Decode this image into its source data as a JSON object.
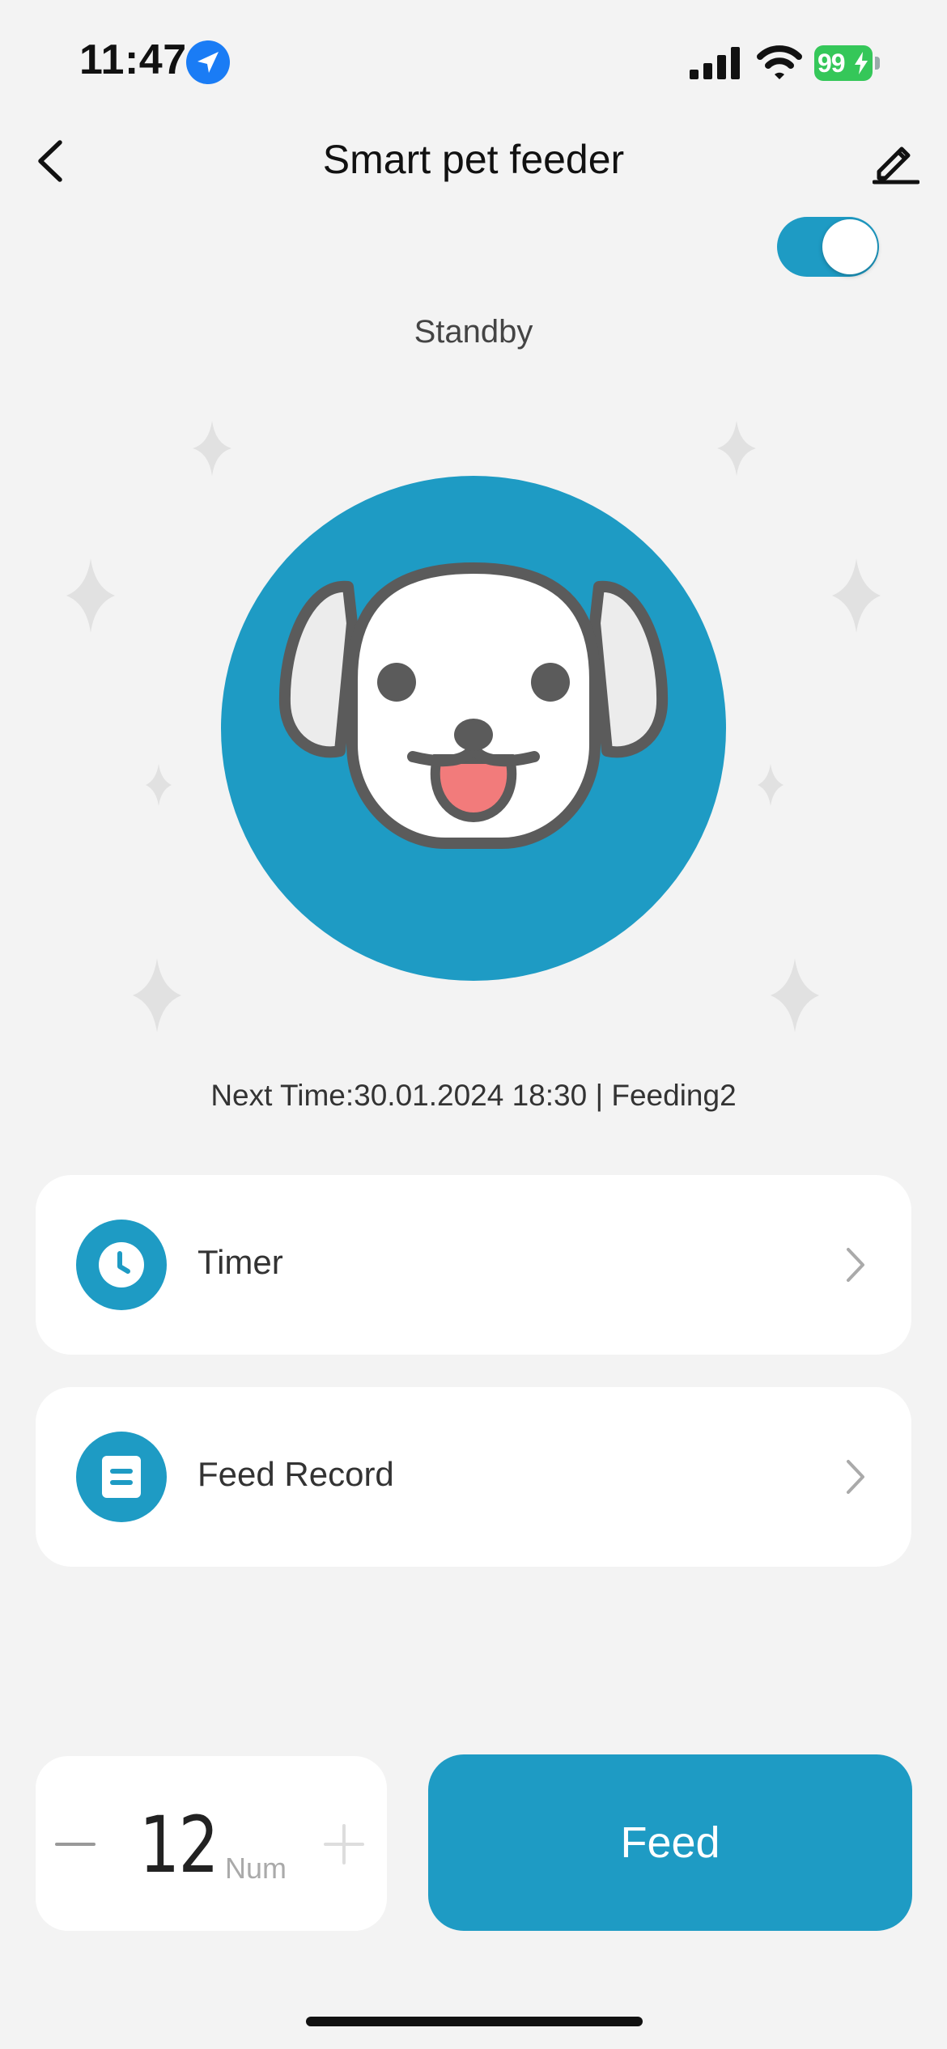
{
  "status_bar": {
    "time": "11:47",
    "battery_level": "99",
    "icons": [
      "location-arrow-icon",
      "cellular-signal-icon",
      "wifi-icon",
      "battery-charging-icon"
    ]
  },
  "header": {
    "title": "Smart pet feeder",
    "back_icon": "chevron-left-icon",
    "edit_icon": "pencil-icon"
  },
  "power_toggle": {
    "on": true
  },
  "device_status": "Standby",
  "hero": {
    "image": "dog-face-icon"
  },
  "next_feeding": "Next Time:30.01.2024 18:30 | Feeding2",
  "menu": [
    {
      "label": "Timer",
      "icon": "clock-icon"
    },
    {
      "label": "Feed Record",
      "icon": "document-icon"
    }
  ],
  "portion": {
    "value": "12",
    "unit": "Num"
  },
  "feed_button": "Feed",
  "colors": {
    "accent": "#1e9bc4",
    "background": "#f3f3f3",
    "card": "#ffffff",
    "battery": "#35c759"
  }
}
